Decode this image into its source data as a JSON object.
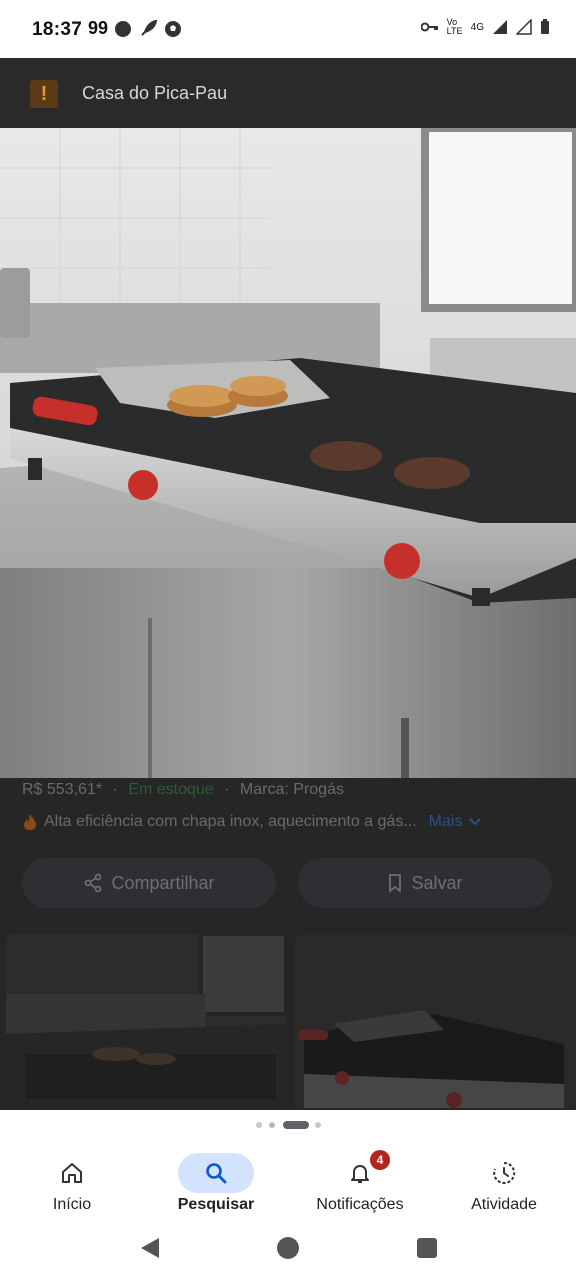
{
  "status_bar": {
    "time": "18:37",
    "extra": "99",
    "network_label": "Vo LTE",
    "network_type": "4G"
  },
  "site": {
    "name": "Casa do Pica-Pau",
    "favicon_glyph": "!"
  },
  "product": {
    "price": "R$ 553,61*",
    "separator": "·",
    "stock": "Em estoque",
    "brand": "Marca: Progás",
    "description": "Alta eficiência com chapa inox, aquecimento a gás...",
    "more": "Mais",
    "fire_icon": "fire-icon"
  },
  "actions": {
    "share": "Compartilhar",
    "save": "Salvar"
  },
  "gallery": {
    "current_index": 3,
    "dot_count": 4
  },
  "bottom_nav": {
    "items": [
      {
        "label": "Início",
        "icon": "home-icon"
      },
      {
        "label": "Pesquisar",
        "icon": "search-icon"
      },
      {
        "label": "Notificações",
        "icon": "bell-icon"
      },
      {
        "label": "Atividade",
        "icon": "activity-icon"
      }
    ],
    "notification_count": "4"
  },
  "colors": {
    "accent_selected": "#d3e3fd",
    "stock_green": "#2f5a36",
    "link_blue": "#2b4f8c",
    "badge_red": "#b3261e"
  }
}
